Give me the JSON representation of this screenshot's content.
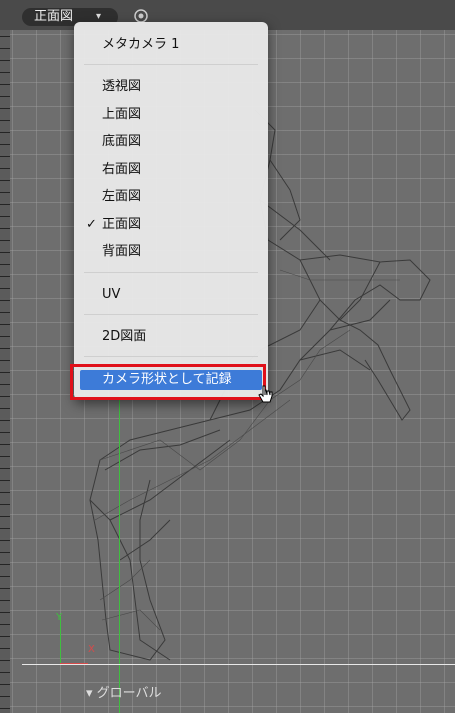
{
  "toolbar": {
    "view_label": "正面図",
    "caret": "▾"
  },
  "menu": {
    "top": "メタカメラ 1",
    "views": [
      {
        "label": "透視図",
        "checked": false
      },
      {
        "label": "上面図",
        "checked": false
      },
      {
        "label": "底面図",
        "checked": false
      },
      {
        "label": "右面図",
        "checked": false
      },
      {
        "label": "左面図",
        "checked": false
      },
      {
        "label": "正面図",
        "checked": true
      },
      {
        "label": "背面図",
        "checked": false
      }
    ],
    "uv": "UV",
    "drawing2d": "2D図面",
    "record": "カメラ形状として記録",
    "check_mark": "✓"
  },
  "axes": {
    "y": "Y",
    "x": "X"
  },
  "footer": {
    "global": "▾ グローバル"
  },
  "colors": {
    "highlight": "#3d7bd8",
    "annotation": "#e0101a",
    "y_axis": "#3fbf3f",
    "x_axis": "#d64a4a"
  }
}
